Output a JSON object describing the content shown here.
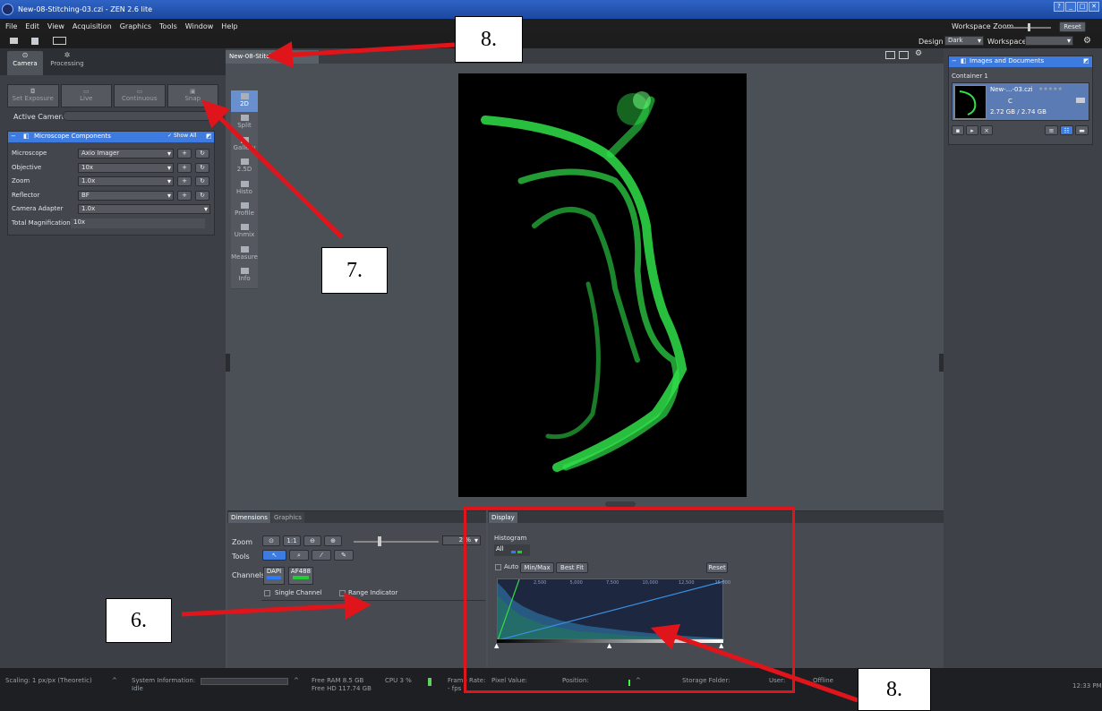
{
  "window": {
    "title": "New-08-Stitching-03.czi - ZEN 2.6 lite",
    "controls": [
      "?",
      "_",
      "□",
      "✕"
    ]
  },
  "menu": [
    "File",
    "Edit",
    "View",
    "Acquisition",
    "Graphics",
    "Tools",
    "Window",
    "Help"
  ],
  "workspace": {
    "zoom_label": "Workspace Zoom",
    "reset_label": "Reset",
    "design_label": "Design",
    "design_value": "Dark",
    "workspace_label": "Workspace"
  },
  "left": {
    "tabs": [
      "Camera",
      "Processing"
    ],
    "camera_buttons": [
      "Set Exposure",
      "Live",
      "Continuous",
      "Snap"
    ],
    "active_camera_label": "Active Camera",
    "components": {
      "title": "Microscope Components",
      "show_all": "Show All",
      "rows": [
        {
          "label": "Microscope",
          "value": "Axio Imager"
        },
        {
          "label": "Objective",
          "value": "10x"
        },
        {
          "label": "Zoom",
          "value": "1.0x"
        },
        {
          "label": "Reflector",
          "value": "BF"
        },
        {
          "label": "Camera Adapter",
          "value": "1.0x"
        },
        {
          "label": "Total Magnification",
          "value": "10x"
        }
      ]
    }
  },
  "center": {
    "doc_tab": "New-08-Stitch",
    "view_tools": [
      "2D",
      "Split",
      "Gallery",
      "2.5D",
      "Histo",
      "Profile",
      "Unmix",
      "Measure",
      "Info"
    ],
    "bottom_tabs": [
      "Dimensions",
      "Graphics"
    ],
    "zoom_label": "Zoom",
    "zoom_value": "2 %",
    "tools_label": "Tools",
    "channels_label": "Channels",
    "channels": [
      "DAPI",
      "AF488"
    ],
    "single_channel": "Single Channel",
    "range_indicator": "Range Indicator",
    "display": {
      "tab": "Display",
      "histogram_label": "Histogram",
      "all_label": "All",
      "auto_label": "Auto",
      "minmax_label": "Min/Max",
      "bestfit_label": "Best Fit",
      "reset_label": "Reset",
      "ticks": [
        "2,500",
        "5,000",
        "7,500",
        "10,000",
        "12,500",
        "15,000"
      ]
    }
  },
  "right": {
    "panel_title": "Images and Documents",
    "container": "Container 1",
    "file_name": "New-...-03.czi",
    "file_size": "2.72 GB / 2.74 GB",
    "file_stars": "★★★★★",
    "file_flag": "C"
  },
  "status": {
    "scaling": "Scaling: 1 px/px (Theoretic)",
    "system_info": "System Information:",
    "system_state": "Idle",
    "free_ram": "Free RAM 8.5 GB",
    "free_hd": "Free HD 117.74 GB",
    "cpu": "CPU 3 %",
    "frame_rate": "Frame Rate:",
    "fps": "- fps",
    "pixel_value": "Pixel Value:",
    "position": "Position:",
    "storage_folder": "Storage Folder:",
    "user": "User:",
    "offline": "Offline",
    "time": "12:33 PM"
  },
  "callouts": {
    "top": "8.",
    "snap": "7.",
    "range": "6.",
    "display": "8."
  },
  "colors": {
    "accent": "#3d7be0",
    "annotation": "#e0141b",
    "fluor": "#2fe04a"
  }
}
